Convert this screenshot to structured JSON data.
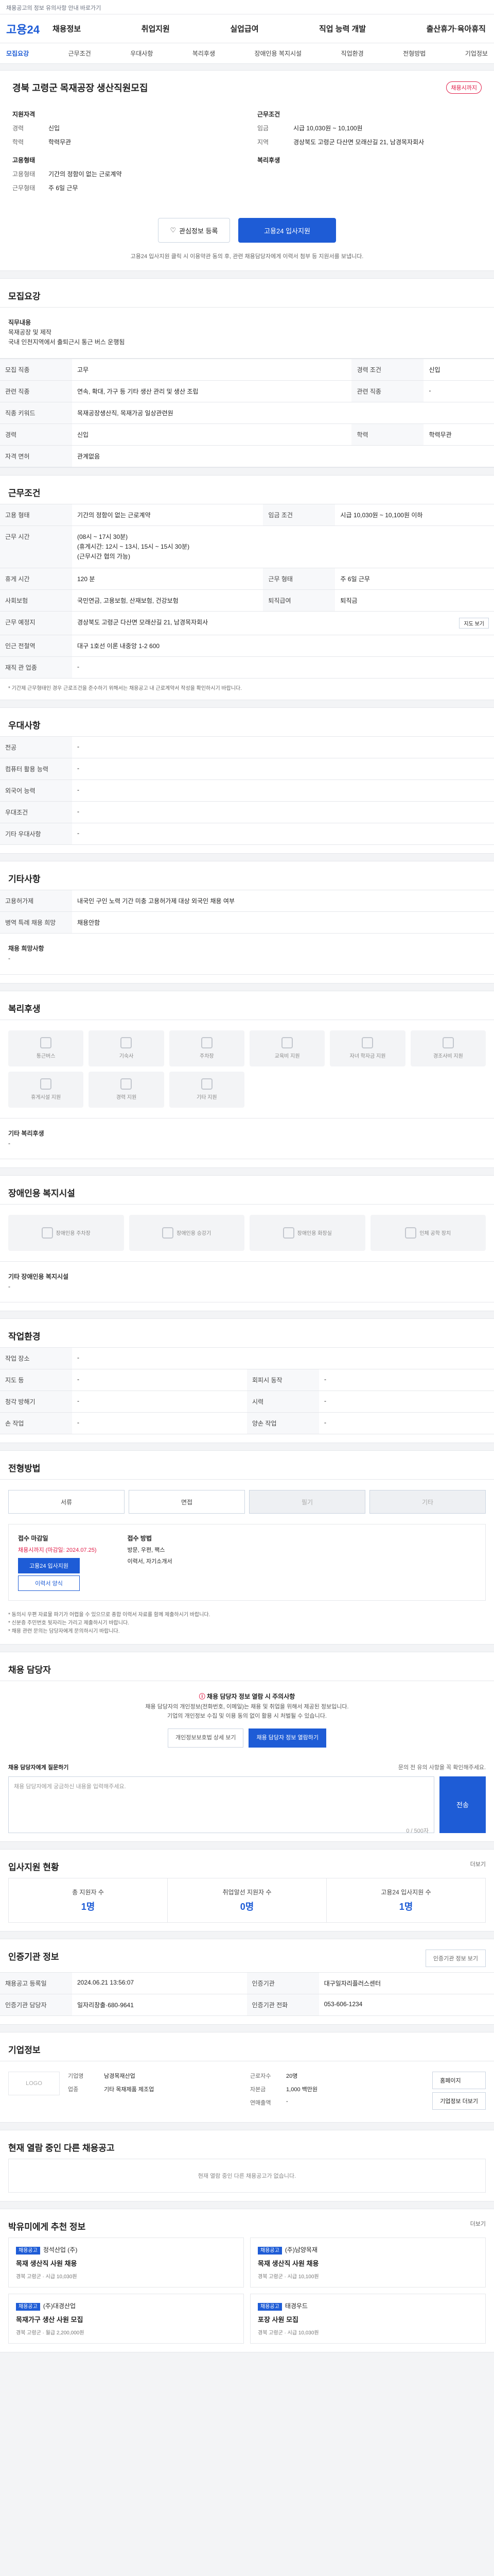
{
  "topbar": {
    "notice": "채용공고의 정보 유의사항 안내 바로가기"
  },
  "gnb": {
    "logo": "고용24",
    "menu": [
      "채용정보",
      "취업지원",
      "실업급여",
      "직업 능력 개발",
      "출산휴가·육아휴직"
    ]
  },
  "tabs": [
    "모집요강",
    "근무조건",
    "우대사항",
    "복리후생",
    "장애인용 복지시설",
    "직업환경",
    "전형방법",
    "기업정보"
  ],
  "job": {
    "title": "경북 고령군 목재공장 생산직원모집",
    "status_badge": "채용시까지",
    "company_label": "기업정보",
    "summary_left": [
      {
        "k": "지원자격",
        "v": ""
      },
      {
        "k": "경력",
        "v": "신입"
      },
      {
        "k": "학력",
        "v": "학력무관"
      }
    ],
    "summary_right": [
      {
        "k": "근무조건",
        "v": ""
      },
      {
        "k": "임금",
        "v": "시급 10,030원 ~ 10,100원"
      },
      {
        "k": "지역",
        "v": "경상북도 고령군 다산면 모래산길 21, 남경목자회사"
      }
    ],
    "employ_label": "고용형태",
    "welfare_label": "복리후생",
    "employ_items": [
      {
        "k": "고용형태",
        "v": "기간의 정함이 없는 근로계약"
      },
      {
        "k": "근무형태",
        "v": "주 6일 근무"
      }
    ],
    "btn_interest": "관심정보 등록",
    "btn_apply": "고용24 입사지원",
    "apply_note": "고용24 입사지원 클릭 시 이용약관 동의 후, 관련 채용담당자에게 이력서 첨부 등 지원서를 보냅니다."
  },
  "recruit": {
    "title": "모집요강",
    "desc_title": "직무내용",
    "desc": [
      "목재공장 및 제작",
      "국내 인천지역에서 출퇴근시 통근 버스 운행됨"
    ],
    "rows": [
      [
        "모집 직종",
        "고무",
        "경력 조건",
        "신입"
      ],
      [
        "관련 직종",
        "연속, 확대, 가구 등 기타 생산 관리 및 생산 조립",
        "관련 직종",
        "-"
      ],
      [
        "직종 키워드",
        "목재공장생산직, 목재가공 일상관련원",
        "",
        ""
      ],
      [
        "경력",
        "신입",
        "학력",
        "학력무관"
      ],
      [
        "자격 면허",
        "관계없음",
        "",
        ""
      ]
    ]
  },
  "work": {
    "title": "근무조건",
    "rows": [
      [
        "고용 형태",
        "기간의 정함이 없는 근로계약",
        "임금 조건",
        "시급 10,030원 ~ 10,100원 이하"
      ],
      [
        "근무 시간",
        "(08시 ~ 17시 30분)\n(휴게시간: 12시 ~ 13시, 15시 ~ 15시 30분)\n(근무시간 협의 가능)",
        "",
        ""
      ],
      [
        "휴게 시간",
        "120 분",
        "근무 형태",
        "주 6일 근무"
      ],
      [
        "사회보험",
        "국민연금, 고용보험, 산재보험, 건강보험",
        "퇴직급여",
        "퇴직금"
      ],
      [
        "근무 예정지",
        "경상북도 고령군 다산면 모래산길 21, 남경목자회사",
        "",
        ""
      ],
      [
        "인근 전철역",
        "대구 1호선 이론 내중앙 1-2 600",
        "",
        ""
      ],
      [
        "재직 관 업종",
        "-",
        "",
        ""
      ]
    ],
    "map_btn": "지도 보기",
    "note": "* 기간제 근무형태인 경우 근로조건을 준수하기 위해서는 채용공고 내 근로계약서 작성을 확인하시기 바랍니다."
  },
  "pref": {
    "title": "우대사항",
    "rows": [
      [
        "전공",
        "-"
      ],
      [
        "컴퓨터 활용 능력",
        "-"
      ],
      [
        "외국어 능력",
        "-"
      ],
      [
        "우대조건",
        "-"
      ],
      [
        "기타 우대사항",
        "-"
      ]
    ]
  },
  "etc": {
    "title": "기타사항",
    "rows": [
      [
        "고용허가제",
        "내국인 구인 노력 기간 미충 고용허가제 대상 외국인 채용 여부"
      ],
      [
        "병역 특례 채용 희망",
        "채용안함"
      ]
    ],
    "hire_label": "채용 희망사항",
    "hire_value": "-"
  },
  "welfare": {
    "title": "복리후생",
    "items": [
      "통근버스",
      "기숙사",
      "주차장",
      "교육비 지원",
      "자녀 학자금 지원",
      "경조사비 지원",
      "휴게시설 지원",
      "경력 지원",
      "기타 지원"
    ],
    "other_label": "기타 복리후생",
    "other_value": "-"
  },
  "disabled": {
    "title": "장애인용 복지시설",
    "items": [
      "장애인용 주차장",
      "장애인용 승강기",
      "장애인용 화장실",
      "인체 공학 장치"
    ],
    "other_label": "기타 장애인용 복지시설",
    "other_value": "-"
  },
  "env": {
    "title": "작업환경",
    "rows": [
      [
        "작업 장소",
        "-",
        "",
        ""
      ],
      [
        "지도 등",
        "-",
        "회피시 동작",
        "-"
      ],
      [
        "청각 방해기",
        "-",
        "시력",
        "-"
      ],
      [
        "손 작업",
        "-",
        "양손 작업",
        "-"
      ]
    ]
  },
  "method": {
    "title": "전형방법",
    "methods": [
      "서류",
      "면접",
      "필기",
      "기타"
    ],
    "deadline_title": "접수 마감일",
    "deadline_value": "채용시까지 (마감일: 2024.07.25)",
    "submit_title": "접수 방법",
    "submit_value": "방문, 우편, 팩스",
    "apply_btn": "고용24 입사지원",
    "apply_btn2": "이력서 양식",
    "docs": "이력서, 자기소개서",
    "footnote": [
      "* 동의시 우편 자료물 파기가 어렵을 수 있으므로 종합 이력서 자료를 함께 제출하시기 바랍니다.",
      "* 신분증 주민번호 뒷자리는 가리고 제출하시기 바랍니다.",
      "* 채용 관련 문의는 담당자에게 문의하시기 바랍니다."
    ]
  },
  "contact": {
    "title": "채용 담당자",
    "notice_title": "채용 담당자 정보 열람 시 주의사항",
    "notice_body": "채용 담당자의 개인정보(전화번호, 이메일)는 채용 및 취업을 위해서 제공된 정보입니다.\n기업의 개인정보 수집 및 이용 동의 없이 활용 시 처벌될 수 있습니다.",
    "btn_personal": "개인정보보호법 상세 보기",
    "btn_view": "채용 담당자 정보 열람하기",
    "msg_title": "채용 담당자에게 질문하기",
    "msg_hint": "문의 전 유의 사항을 꼭 확인해주세요.",
    "msg_placeholder": "채용 담당자에게 궁금하신 내용을 입력해주세요.",
    "msg_count": "0 / 500자",
    "send": "전송"
  },
  "stats": {
    "title": "입사지원 현황",
    "more": "더보기",
    "items": [
      {
        "label": "총 지원자 수",
        "value": "1명"
      },
      {
        "label": "취업알선 지원자 수",
        "value": "0명"
      },
      {
        "label": "고용24 입사지원 수",
        "value": "1명"
      }
    ]
  },
  "auth": {
    "title": "인증기관 정보",
    "rows": [
      [
        "채용공고 등록일",
        "2024.06.21 13:56:07",
        "인증기관",
        "대구일자리플러스센터"
      ],
      [
        "인증기관 담당자",
        "일자리창출·680-9641",
        "인증기관 전화",
        "053-606-1234"
      ]
    ],
    "btn": "인증기관 정보 보기"
  },
  "company": {
    "title": "기업정보",
    "logo": "LOGO",
    "rows": [
      [
        "기업명",
        "남경목재산업"
      ],
      [
        "업종",
        "기타 목재제품 제조업"
      ],
      [
        "근로자수",
        "20명"
      ],
      [
        "자본금",
        "1,000 백만원"
      ],
      [
        "연매출액",
        "-"
      ]
    ],
    "btn1": "홈페이지",
    "btn2": "기업정보 더보기"
  },
  "similar": {
    "title": "현재 열람 중인 다른 채용공고",
    "empty": "현재 열람 중인 다른 채용공고가 없습니다."
  },
  "recommend": {
    "title": "박유미에게 추천 정보",
    "more": "더보기",
    "items": [
      {
        "tag": "채용공고",
        "co": "정석산업 (주)",
        "title": "목재 생산직 사원 채용",
        "meta": "경북 고령군 · 시급 10,030원"
      },
      {
        "tag": "채용공고",
        "co": "(주)남양목재",
        "title": "목재 생산직 사원 채용",
        "meta": "경북 고령군 · 시급 10,100원"
      },
      {
        "tag": "채용공고",
        "co": "(주)대경산업",
        "title": "목재가구 생산 사원 모집",
        "meta": "경북 고령군 · 월급 2,200,000원"
      },
      {
        "tag": "채용공고",
        "co": "태경우드",
        "title": "포장 사원 모집",
        "meta": "경북 고령군 · 시급 10,030원"
      }
    ]
  }
}
